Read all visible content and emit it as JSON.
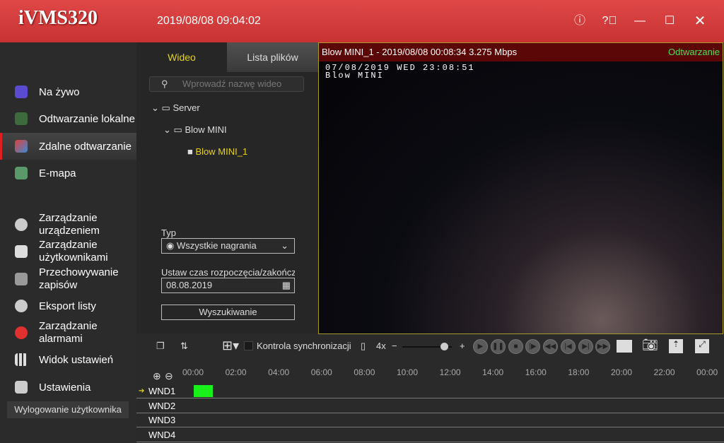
{
  "header": {
    "logo": "iVMS320",
    "datetime": "2019/08/08 09:04:02",
    "buttons": [
      "info-icon",
      "help-icon",
      "minimize-icon",
      "maximize-icon",
      "close-icon"
    ]
  },
  "sidebar": {
    "items": [
      {
        "label": "Na żywo",
        "icon": "live-view-icon"
      },
      {
        "label": "Odtwarzanie lokalne",
        "icon": "local-playback-icon"
      },
      {
        "label": "Zdalne odtwarzanie",
        "icon": "remote-playback-icon",
        "active": true
      },
      {
        "label": "E-mapa",
        "icon": "emap-icon"
      },
      {
        "label": "Zarządzanie urządzeniem",
        "icon": "device-management-icon"
      },
      {
        "label": "Zarządzanie użytkownikami",
        "icon": "user-management-icon"
      },
      {
        "label": "Przechowywanie zapisów",
        "icon": "storage-icon"
      },
      {
        "label": "Eksport listy",
        "icon": "export-icon"
      },
      {
        "label": "Zarządzanie alarmami",
        "icon": "alarm-icon"
      },
      {
        "label": "Widok ustawień",
        "icon": "view-settings-icon"
      },
      {
        "label": "Ustawienia",
        "icon": "settings-icon"
      }
    ],
    "logout": "Wylogowanie użytkownika"
  },
  "panel": {
    "tabs": [
      "Wideo",
      "Lista plików"
    ],
    "search_placeholder": "Wprowadź nazwę wideo",
    "tree": {
      "root": "Server",
      "device": "Blow MINI",
      "channel": "Blow MINI_1"
    },
    "type_label": "Typ",
    "type_value": "Wszystkie nagrania",
    "time_label": "Ustaw czas rozpoczęcia/zakończenia",
    "date_value": "08.08.2019",
    "search_button": "Wyszukiwanie"
  },
  "video": {
    "title": "Blow MINI_1 - 2019/08/08 00:08:34 3.275 Mbps",
    "status": "Odtwarzanie",
    "osd_line1": "07/08/2019 WED 23:08:51",
    "osd_line2": "Blow MINI"
  },
  "toolbar": {
    "sync_label": "Kontrola synchronizacji",
    "speed": "4x",
    "speed_minus": "−",
    "speed_plus": "+",
    "speed_level": 0.75
  },
  "timeline": {
    "ticks": [
      "00:00",
      "02:00",
      "04:00",
      "06:00",
      "08:00",
      "10:00",
      "12:00",
      "14:00",
      "16:00",
      "18:00",
      "20:00",
      "22:00",
      "00:00"
    ],
    "rows": [
      "WND1",
      "WND2",
      "WND3",
      "WND4"
    ],
    "recording": {
      "row": "WND1",
      "start_hour": 0.0,
      "end_hour": 0.9,
      "color": "#19f019"
    }
  },
  "colors": {
    "accent": "#d63a3a",
    "active_text": "#e6d21c"
  }
}
